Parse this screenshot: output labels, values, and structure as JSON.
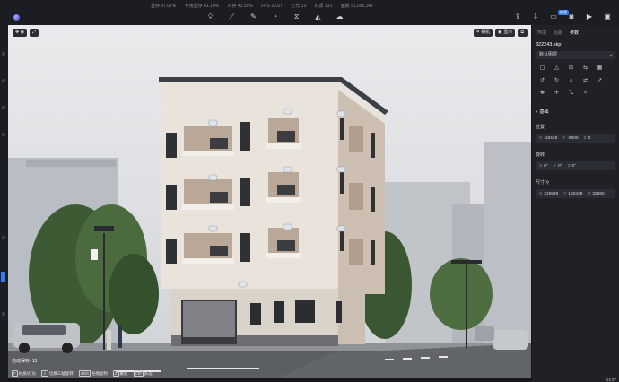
{
  "topbar": {
    "stats": [
      "显存 37.07%",
      "专用显存 81.10%",
      "内存 41.55%",
      "FPS 23.07",
      "灯光 13",
      "材质 131",
      "面数 51,666,347"
    ],
    "mode_icons": [
      "light-bulb-icon",
      "measure-icon",
      "brush-icon",
      "timer-icon",
      "mirror-icon",
      "cone-icon",
      "cloud-icon"
    ],
    "right_icons": [
      "share-icon",
      "export-icon",
      "render-icon",
      "camera-icon",
      "video-icon",
      "panorama-icon"
    ],
    "new_badge": "新版"
  },
  "viewport": {
    "toolbar_left": [
      "✥ ◉",
      "⤢"
    ],
    "toolbar_right": {
      "camera_label": "相机",
      "display_label": "显示",
      "layout_icon": "layout-icon"
    },
    "status": "自动保存: 13",
    "hints": [
      {
        "key": "F",
        "label": "材质/灯光"
      },
      {
        "key": "⇧",
        "label": "切换三轴旋转"
      },
      {
        "key": "Shift",
        "label": "拖拽复制"
      },
      {
        "key": "Z",
        "label": "聚焦"
      },
      {
        "key": "Ctrl",
        "label": "多选"
      }
    ]
  },
  "panel": {
    "tabs": [
      "环境",
      "后期",
      "参数"
    ],
    "active_tab": "参数",
    "file": "322243.skp",
    "scene_select": "默认图层",
    "tool_icons": [
      "copy-icon",
      "align-icon",
      "group-icon",
      "flip-icon",
      "grid-icon",
      "rotate-left-icon",
      "rotate-right-icon",
      "home-icon",
      "replace-icon",
      "export-icon",
      "move-icon",
      "center-icon",
      "scale-icon",
      "sparkle-icon"
    ],
    "section": "基础",
    "position": {
      "label": "位置",
      "x": "-18438",
      "y": "-8506",
      "z": "0"
    },
    "rotation": {
      "label": "旋转",
      "x": "0°",
      "y": "0°",
      "z": "0°"
    },
    "size": {
      "label": "尺寸",
      "x": "219548",
      "y": "160439",
      "z": "32066"
    }
  },
  "clock": "14:37",
  "colors": {
    "accent": "#2f7df6",
    "panel": "#1f2126",
    "sky": "#dcdee1"
  }
}
